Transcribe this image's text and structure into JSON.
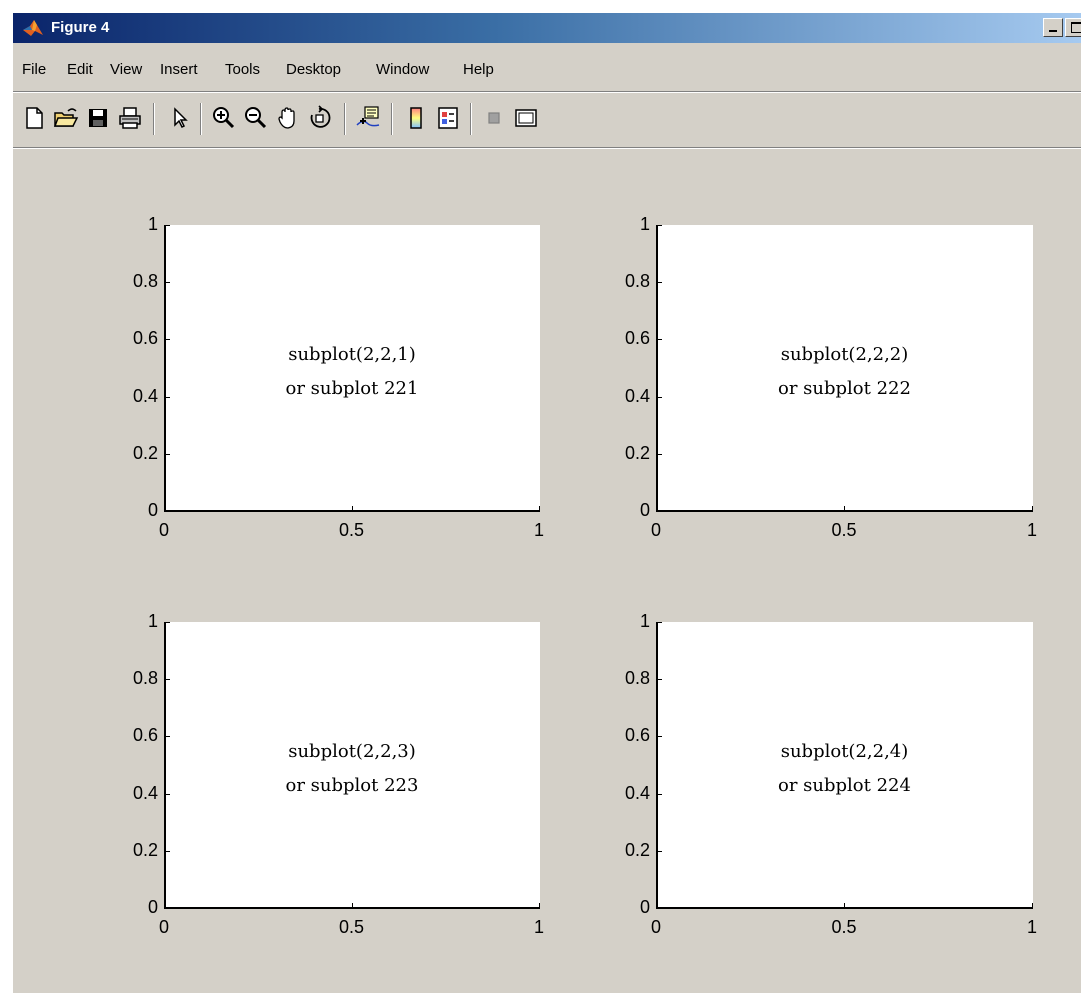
{
  "window": {
    "title": "Figure 4",
    "background": "#d4d0c8"
  },
  "menu": [
    "File",
    "Edit",
    "View",
    "Insert",
    "Tools",
    "Desktop",
    "Window",
    "Help"
  ],
  "toolbar": [
    "new-figure-icon",
    "open-file-icon",
    "save-icon",
    "print-icon",
    "edit-plot-arrow-icon",
    "zoom-in-icon",
    "zoom-out-icon",
    "pan-hand-icon",
    "rotate-3d-icon",
    "data-cursor-icon",
    "insert-colorbar-icon",
    "insert-legend-icon",
    "hide-plot-tools-icon",
    "show-plot-tools-icon"
  ],
  "chart_data": [
    {
      "type": "scatter",
      "series": [],
      "xlim": [
        0,
        1
      ],
      "ylim": [
        0,
        1
      ],
      "xticks": [
        "0",
        "0.5",
        "1"
      ],
      "yticks": [
        "0",
        "0.2",
        "0.4",
        "0.6",
        "0.8",
        "1"
      ],
      "annotation": [
        "subplot(2,2,1)",
        "or subplot 221"
      ]
    },
    {
      "type": "scatter",
      "series": [],
      "xlim": [
        0,
        1
      ],
      "ylim": [
        0,
        1
      ],
      "xticks": [
        "0",
        "0.5",
        "1"
      ],
      "yticks": [
        "0",
        "0.2",
        "0.4",
        "0.6",
        "0.8",
        "1"
      ],
      "annotation": [
        "subplot(2,2,2)",
        "or subplot 222"
      ]
    },
    {
      "type": "scatter",
      "series": [],
      "xlim": [
        0,
        1
      ],
      "ylim": [
        0,
        1
      ],
      "xticks": [
        "0",
        "0.5",
        "1"
      ],
      "yticks": [
        "0",
        "0.2",
        "0.4",
        "0.6",
        "0.8",
        "1"
      ],
      "annotation": [
        "subplot(2,2,3)",
        "or subplot 223"
      ]
    },
    {
      "type": "scatter",
      "series": [],
      "xlim": [
        0,
        1
      ],
      "ylim": [
        0,
        1
      ],
      "xticks": [
        "0",
        "0.5",
        "1"
      ],
      "yticks": [
        "0",
        "0.2",
        "0.4",
        "0.6",
        "0.8",
        "1"
      ],
      "annotation": [
        "subplot(2,2,4)",
        "or subplot 224"
      ]
    }
  ]
}
